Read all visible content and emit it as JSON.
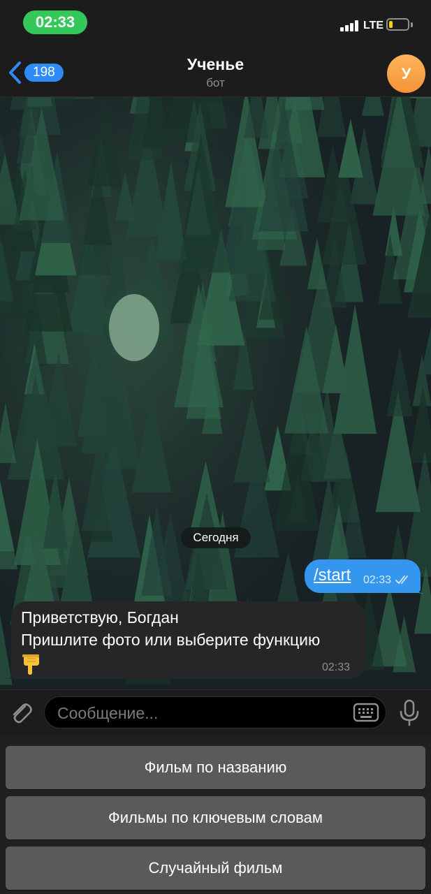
{
  "status_bar": {
    "time": "02:33",
    "network": "LTE",
    "battery_level": 0.18,
    "colors": {
      "time_pill": "#34c759",
      "battery": "#ffcc00"
    }
  },
  "header": {
    "back_count": "198",
    "title": "Ученье",
    "subtitle": "бот",
    "avatar_letter": "У",
    "accent_color": "#2f8cf5"
  },
  "chat": {
    "date_label": "Сегодня",
    "messages": [
      {
        "direction": "outgoing",
        "text": "/start",
        "time": "02:33",
        "status": "read"
      },
      {
        "direction": "incoming",
        "lines": [
          "Приветствую, Богдан",
          "Пришлите фото или выберите функцию"
        ],
        "emoji": "backhand-index-pointing-down",
        "time": "02:33"
      }
    ]
  },
  "input": {
    "placeholder": "Сообщение..."
  },
  "bot_keyboard": {
    "buttons": [
      {
        "label": "Фильм по названию"
      },
      {
        "label": "Фильмы по ключевым словам"
      },
      {
        "label": "Случайный фильм"
      }
    ]
  },
  "icons": [
    "back-chevron-icon",
    "attach-icon",
    "keyboard-icon",
    "microphone-icon",
    "double-check-icon",
    "pointing-down-emoji"
  ]
}
